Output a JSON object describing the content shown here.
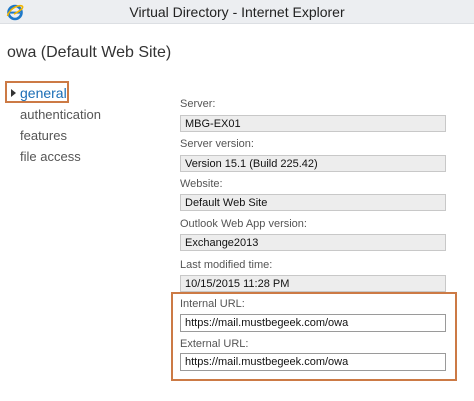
{
  "window": {
    "title": "Virtual Directory - Internet Explorer",
    "icon": "internet-explorer-icon"
  },
  "page": {
    "heading": "owa (Default Web Site)"
  },
  "nav": {
    "items": [
      {
        "label": "general",
        "active": true
      },
      {
        "label": "authentication",
        "active": false
      },
      {
        "label": "features",
        "active": false
      },
      {
        "label": "file access",
        "active": false
      }
    ]
  },
  "fields": {
    "server": {
      "label": "Server:",
      "value": "MBG-EX01"
    },
    "server_version": {
      "label": "Server version:",
      "value": "Version 15.1 (Build 225.42)"
    },
    "website": {
      "label": "Website:",
      "value": "Default Web Site"
    },
    "owa_version": {
      "label": "Outlook Web App version:",
      "value": "Exchange2013"
    },
    "last_modified": {
      "label": "Last modified time:",
      "value": "10/15/2015 11:28 PM"
    },
    "internal_url": {
      "label": "Internal URL:",
      "value": "https://mail.mustbegeek.com/owa"
    },
    "external_url": {
      "label": "External URL:",
      "value": "https://mail.mustbegeek.com/owa"
    }
  },
  "colors": {
    "highlight": "#cc7a45",
    "active_nav": "#1a6db5",
    "readonly_field": "#ededed"
  }
}
